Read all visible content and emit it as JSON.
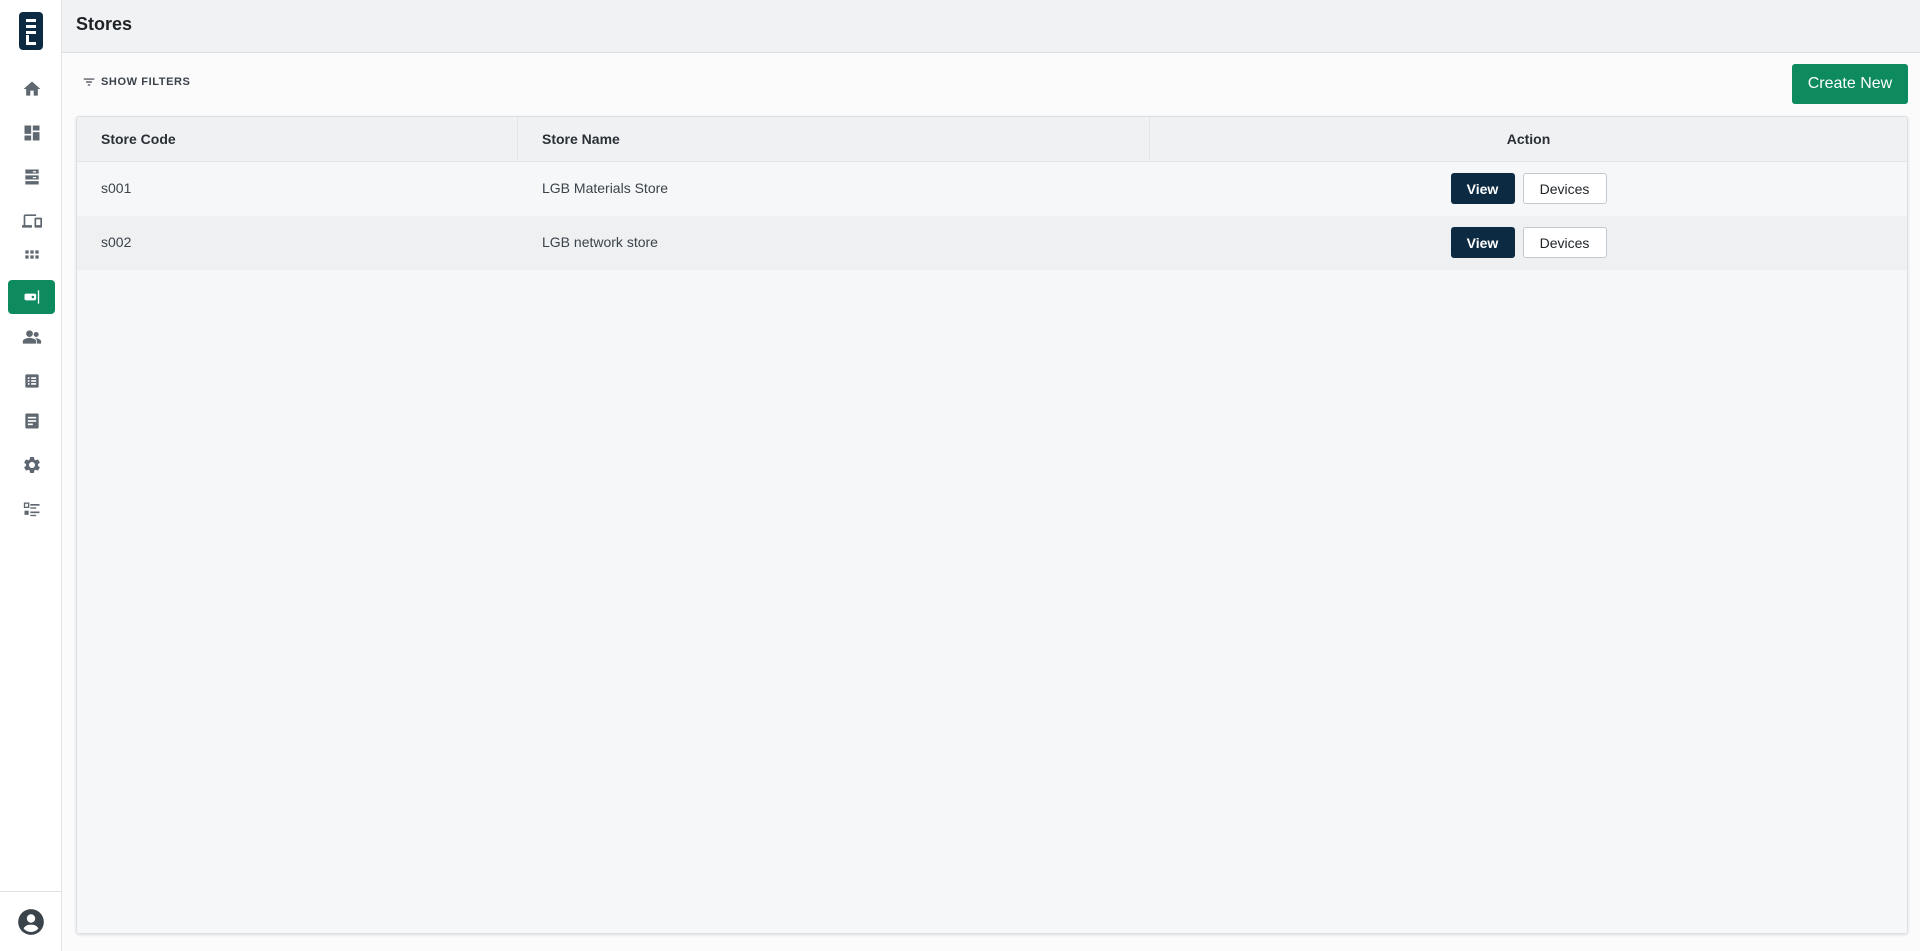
{
  "colors": {
    "accent": "#0e8a5f",
    "primary_dark": "#0c2a42",
    "icon_gray": "#5f6770"
  },
  "sidebar": {
    "items": [
      {
        "icon": "home-icon"
      },
      {
        "icon": "dashboard-icon"
      },
      {
        "icon": "storage-icon"
      },
      {
        "icon": "devices-icon"
      },
      {
        "icon": "apps-grid-icon"
      },
      {
        "icon": "store-tag-icon",
        "active": true
      },
      {
        "icon": "users-icon"
      },
      {
        "icon": "list-icon"
      },
      {
        "icon": "document-icon"
      },
      {
        "icon": "settings-icon"
      },
      {
        "icon": "checklist-icon"
      }
    ],
    "bottom_icon": "account-icon"
  },
  "header": {
    "title": "Stores"
  },
  "toolbar": {
    "filters_label": "SHOW FILTERS",
    "create_label": "Create New"
  },
  "table": {
    "columns": [
      "Store Code",
      "Store Name",
      "Action"
    ],
    "rows": [
      {
        "code": "s001",
        "name": "LGB Materials Store",
        "view_label": "View",
        "devices_label": "Devices"
      },
      {
        "code": "s002",
        "name": "LGB network store",
        "view_label": "View",
        "devices_label": "Devices"
      }
    ]
  }
}
